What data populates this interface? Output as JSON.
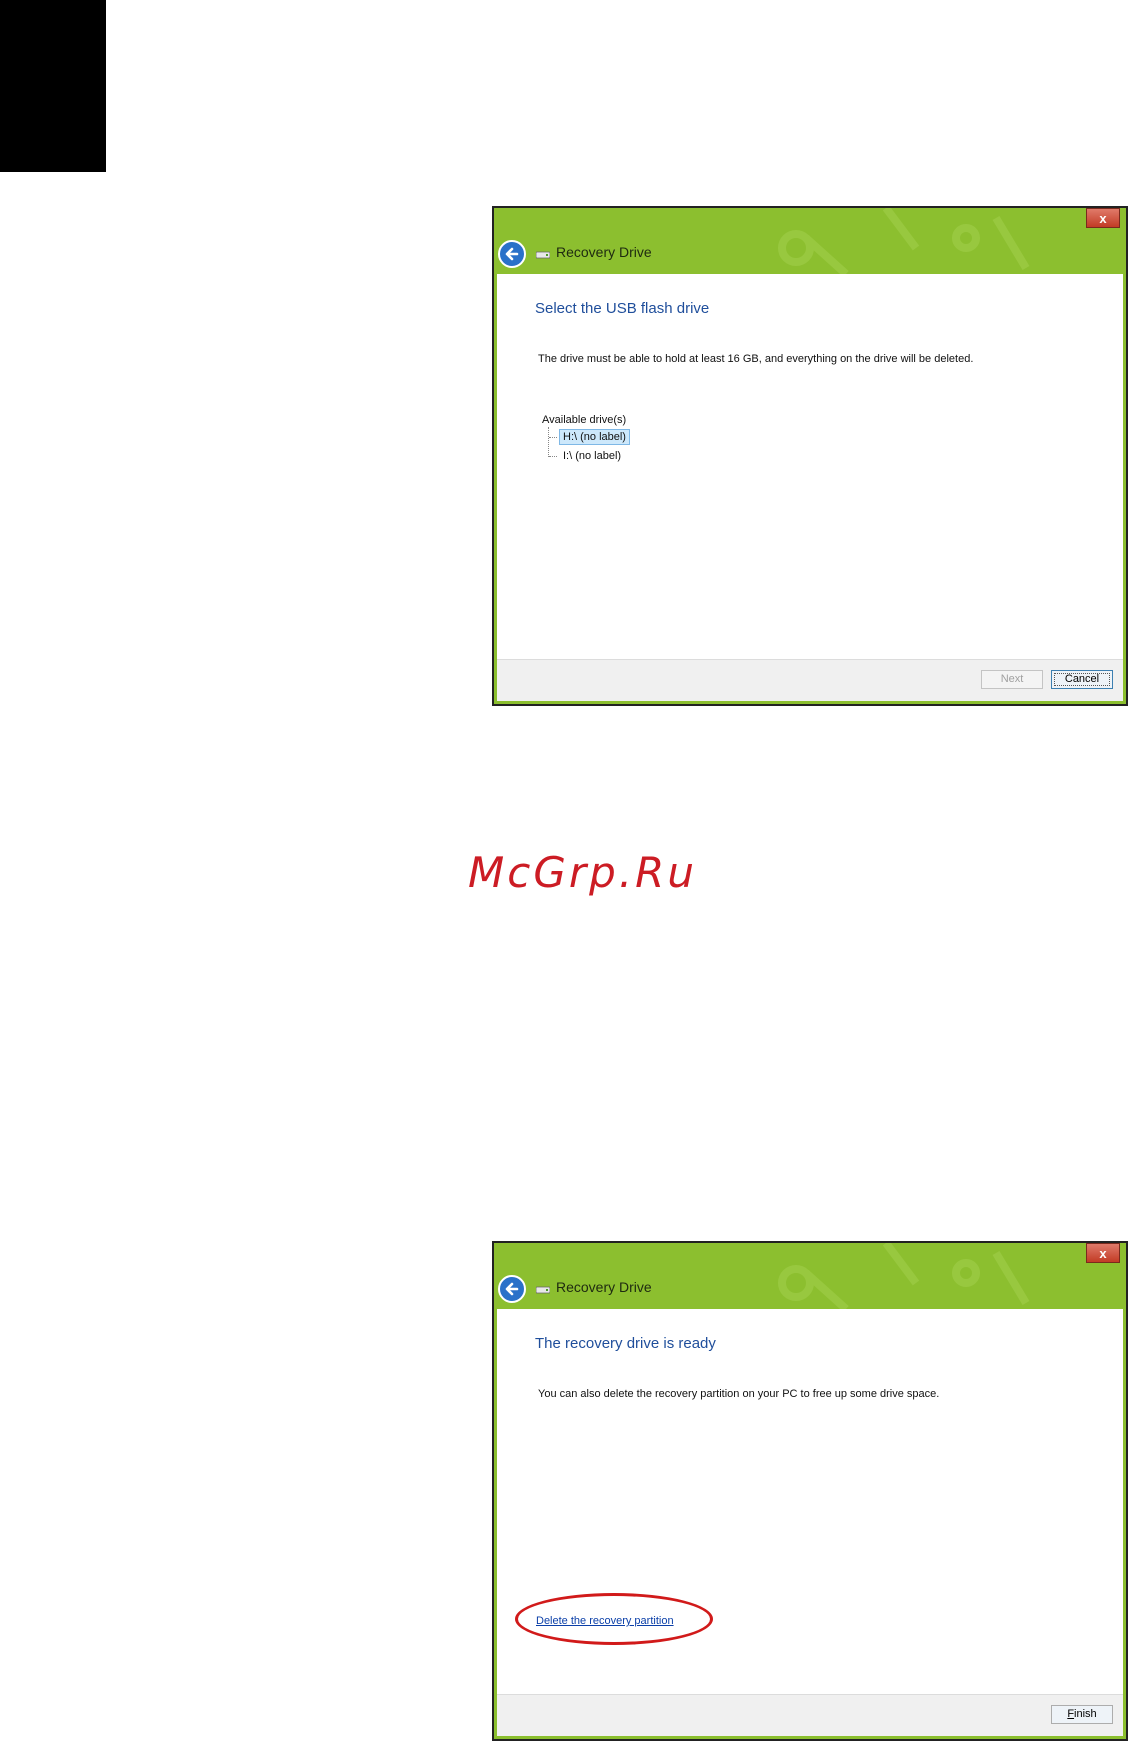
{
  "dialog1": {
    "title": "Recovery Drive",
    "heading": "Select the USB flash drive",
    "body": "The drive must be able to hold at least 16 GB, and everything on the drive will be deleted.",
    "tree_label": "Available drive(s)",
    "drives": [
      "H:\\ (no label)",
      "I:\\ (no label)"
    ],
    "selected_drive": "H:\\ (no label)",
    "next_label": "Next",
    "cancel_label": "Cancel",
    "close_label": "x"
  },
  "watermark": "McGrp.Ru",
  "dialog2": {
    "title": "Recovery Drive",
    "heading": "The recovery drive is ready",
    "body": "You can also delete the recovery partition on your PC to free up some drive space.",
    "link": "Delete the recovery partition",
    "finish_label": "Finish",
    "close_label": "x"
  },
  "colors": {
    "titlebar": "#8cbf2f",
    "heading": "#1f4e9b",
    "link": "#0b3fa8",
    "highlight": "#d11a1a",
    "watermark": "#cc1c24"
  }
}
